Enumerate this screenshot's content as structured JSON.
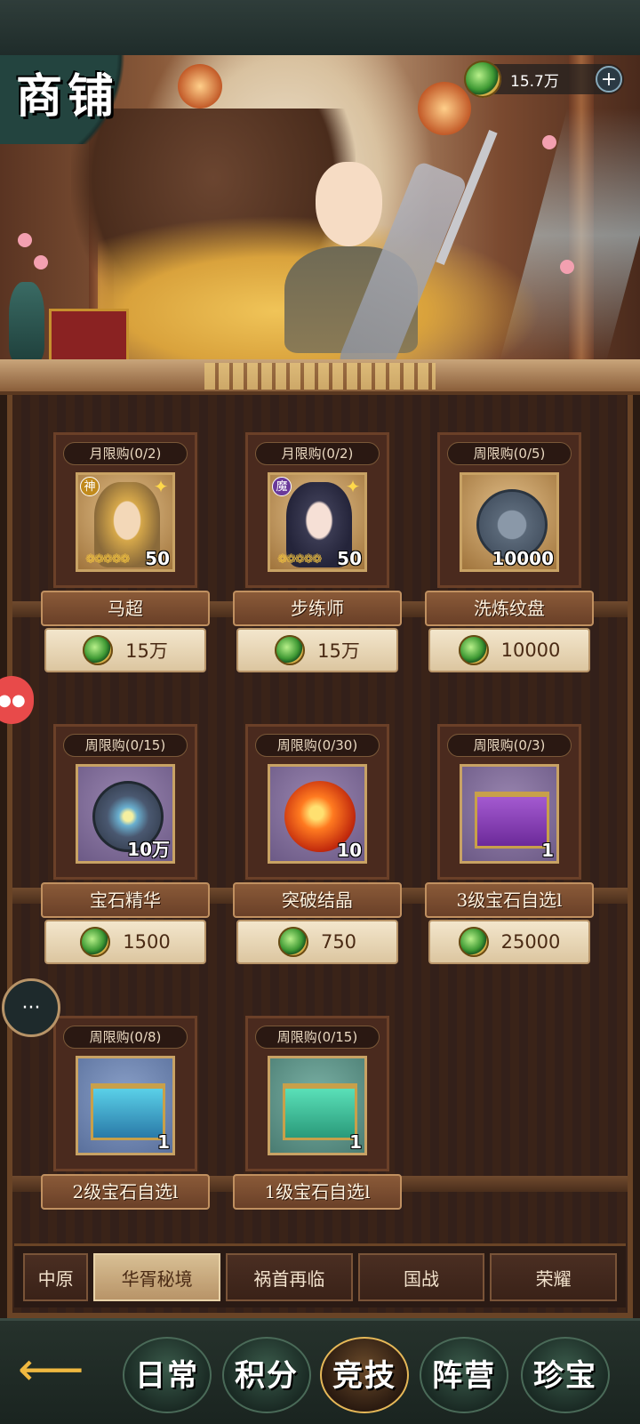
{
  "header": {
    "title": "商铺",
    "currency": {
      "icon": "jade-coin-icon",
      "amount": "15.7万",
      "add": "+"
    }
  },
  "shop_items": [
    {
      "limit": "月限购(0/2)",
      "name": "马超",
      "price": "15万",
      "qty": "50",
      "faction": "神",
      "stars": "❁❁❁❁❁",
      "kind": "hero-gold"
    },
    {
      "limit": "月限购(0/2)",
      "name": "步练师",
      "price": "15万",
      "qty": "50",
      "faction": "魔",
      "stars": "❁❁❁❁❁",
      "kind": "hero-dark"
    },
    {
      "limit": "周限购(0/5)",
      "name": "洗炼纹盘",
      "price": "10000",
      "qty": "10000",
      "kind": "disc-stone"
    },
    {
      "limit": "周限购(0/15)",
      "name": "宝石精华",
      "price": "1500",
      "qty": "10万",
      "kind": "disc-gem"
    },
    {
      "limit": "周限购(0/30)",
      "name": "突破结晶",
      "price": "750",
      "qty": "10",
      "kind": "disc-fire"
    },
    {
      "limit": "周限购(0/3)",
      "name": "3级宝石自选l",
      "price": "25000",
      "qty": "1",
      "kind": "chest-violet"
    },
    {
      "limit": "周限购(0/8)",
      "name": "2级宝石自选l",
      "qty": "1",
      "kind": "chest-blue"
    },
    {
      "limit": "周限购(0/15)",
      "name": "1级宝石自选l",
      "qty": "1",
      "kind": "chest-green"
    }
  ],
  "tabs": [
    "中原",
    "华胥秘境",
    "祸首再临",
    "国战",
    "荣耀"
  ],
  "active_tab": "华胥秘境",
  "bottom_nav": [
    "日常",
    "积分",
    "竞技",
    "阵营",
    "珍宝"
  ],
  "active_nav": "竞技",
  "floating": {
    "chat": "···"
  }
}
